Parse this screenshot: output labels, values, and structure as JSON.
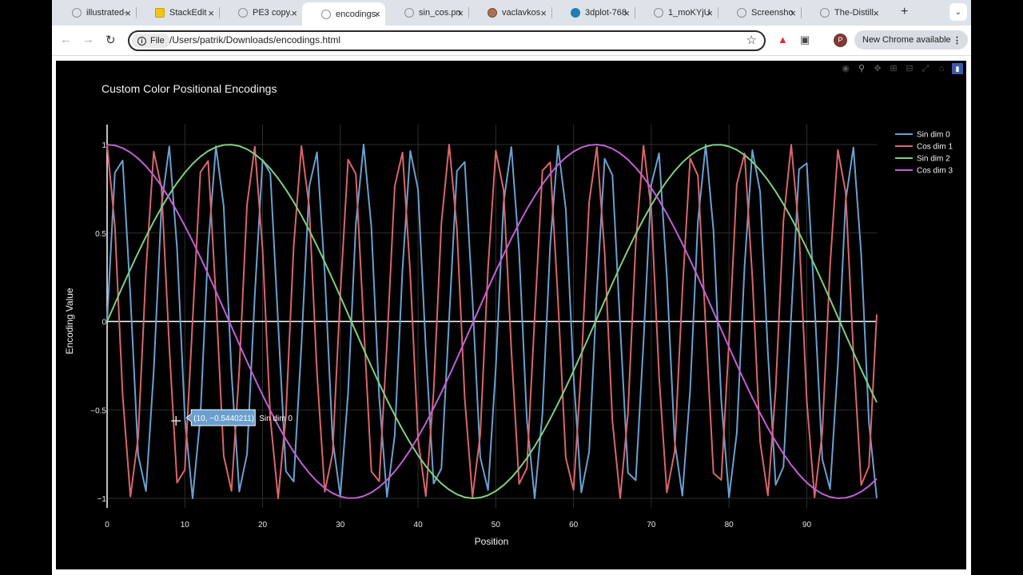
{
  "browser": {
    "tabs": [
      {
        "title": "illustrated-",
        "icon": "globe-icon"
      },
      {
        "title": "StackEdit",
        "icon": "stackedit-icon"
      },
      {
        "title": "PE3 copy.",
        "icon": "globe-icon"
      },
      {
        "title": "encodings.",
        "icon": "globe-icon",
        "active": true
      },
      {
        "title": "sin_cos.pn",
        "icon": "globe-icon"
      },
      {
        "title": "vaclavkos",
        "icon": "profile-icon"
      },
      {
        "title": "3dplot-768",
        "icon": "wordpress-icon"
      },
      {
        "title": "1_moKYjU",
        "icon": "globe-icon"
      },
      {
        "title": "Screensho",
        "icon": "globe-icon"
      },
      {
        "title": "The-Distill",
        "icon": "globe-icon"
      }
    ],
    "address": {
      "chip": "File",
      "url": "/Users/patrik/Downloads/encodings.html"
    },
    "profile_initial": "P",
    "update_label": "New Chrome available"
  },
  "colors": {
    "sin0": "#6aa0d0",
    "cos1": "#d9666c",
    "sin2": "#7fd07f",
    "cos3": "#c35fd6"
  },
  "chart_data": {
    "type": "line",
    "title": "Custom Color Positional Encodings",
    "xlabel": "Position",
    "ylabel": "Encoding Value",
    "xlim": [
      0,
      99
    ],
    "ylim": [
      -1,
      1
    ],
    "xticks": [
      "0",
      "10",
      "20",
      "30",
      "40",
      "50",
      "60",
      "70",
      "80",
      "90"
    ],
    "yticks": [
      "1",
      "0.5",
      "0",
      "−0.5",
      "−1"
    ],
    "grid": true,
    "legend_position": "top-right",
    "x": "integers 0 to 99",
    "series": [
      {
        "name": "Sin dim 0",
        "formula": "sin(x)",
        "color": "#6aa0d0"
      },
      {
        "name": "Cos dim 1",
        "formula": "cos(x)",
        "color": "#d9666c"
      },
      {
        "name": "Sin dim 2",
        "formula": "sin(x / 10)",
        "color": "#7fd07f"
      },
      {
        "name": "Cos dim 3",
        "formula": "cos(x / 10)",
        "color": "#c35fd6"
      }
    ],
    "hover": {
      "point": "(10, −0.5440211)",
      "series": "Sin dim 0"
    }
  }
}
